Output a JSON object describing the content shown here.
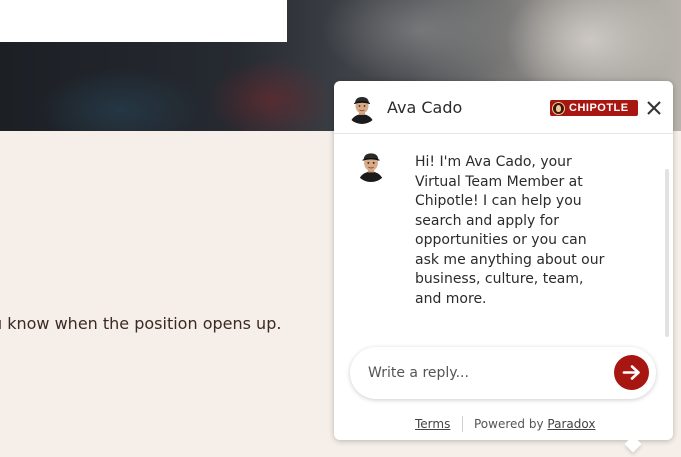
{
  "page": {
    "body_text": "u know when the position opens up."
  },
  "chat": {
    "header": {
      "name": "Ava Cado",
      "brand_label": "CHIPOTLE",
      "close_icon": "close-icon",
      "brand_color": "#a81612"
    },
    "messages": [
      {
        "sender": "Ava Cado",
        "text": "Hi! I'm Ava Cado, your Virtual Team Member at Chipotle! I can help you search and apply for opportunities or you can ask me anything about our business, culture, team, and more."
      }
    ],
    "reply": {
      "placeholder": "Write a reply...",
      "value": "",
      "send_icon": "arrow-right-icon"
    },
    "footer": {
      "terms": "Terms",
      "powered_by": "Powered by",
      "provider": "Paradox"
    }
  }
}
